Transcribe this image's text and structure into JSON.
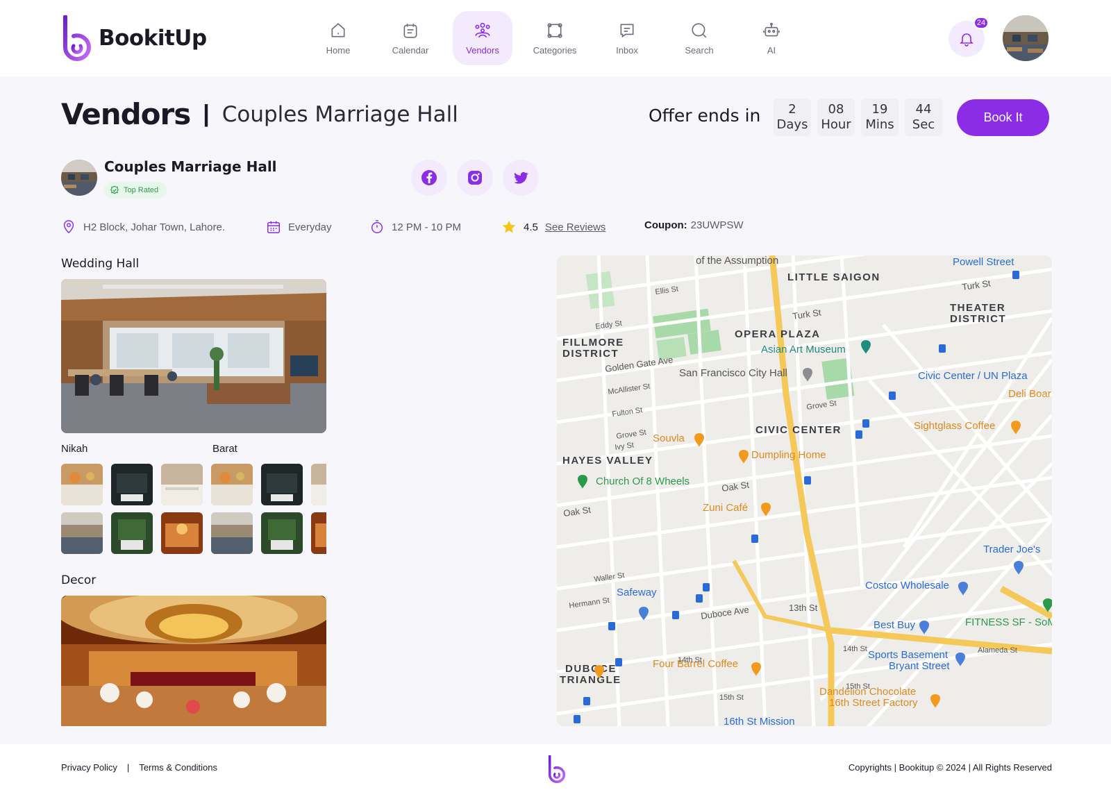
{
  "brand": {
    "name": "BookitUp",
    "accent": "#8b2de6"
  },
  "nav": [
    {
      "label": "Home",
      "icon": "home-icon"
    },
    {
      "label": "Calendar",
      "icon": "calendar-icon"
    },
    {
      "label": "Vendors",
      "icon": "vendors-icon",
      "active": true
    },
    {
      "label": "Categories",
      "icon": "categories-icon"
    },
    {
      "label": "Inbox",
      "icon": "inbox-icon"
    },
    {
      "label": "Search",
      "icon": "search-icon"
    },
    {
      "label": "AI",
      "icon": "robot-icon"
    }
  ],
  "notifications": {
    "count": "24"
  },
  "page": {
    "title": "Vendors",
    "separator": "|",
    "subtitle": "Couples Marriage Hall"
  },
  "offer": {
    "label": "Offer ends in",
    "days": "2",
    "days_label": "Days",
    "hours": "08",
    "hours_label": "Hour",
    "mins": "19",
    "mins_label": "Mins",
    "secs": "44",
    "secs_label": "Sec",
    "book_label": "Book It"
  },
  "vendor": {
    "name": "Couples Marriage Hall",
    "badge": "Top Rated",
    "address": "H2 Block, Johar Town, Lahore.",
    "days": "Everyday",
    "hours": "12 PM - 10 PM",
    "rating": "4.5",
    "reviews_link": "See Reviews",
    "coupon_label": "Coupon:",
    "coupon_code": "23UWPSW"
  },
  "sections": {
    "wedding_hall": "Wedding Hall",
    "nikah": "Nikah",
    "barat": "Barat",
    "decor": "Decor"
  },
  "map": {
    "labels": {
      "little_saigon": "LITTLE SAIGON",
      "assumption": "of the Assumption",
      "powell": "Powell Street",
      "theater": "THEATER",
      "district": "DISTRICT",
      "fillmore": "FILLMORE",
      "fillmore_district": "DISTRICT",
      "opera": "OPERA PLAZA",
      "asian": "Asian Art Museum",
      "city_hall": "San Francisco City Hall",
      "civic_un": "Civic Center / UN Plaza",
      "deli": "Deli Boar",
      "sightglass": "Sightglass Coffee",
      "civic": "CIVIC CENTER",
      "souvla": "Souvla",
      "dumpling": "Dumpling Home",
      "hayes": "HAYES VALLEY",
      "church": "Church Of 8 Wheels",
      "zuni": "Zuni Café",
      "trader": "Trader Joe's",
      "costco": "Costco Wholesale",
      "safeway": "Safeway",
      "best_buy": "Best Buy",
      "fitness": "FITNESS SF - SoM",
      "sports1": "Sports Basement",
      "sports2": "Bryant Street",
      "duboce": "DUBOCE",
      "triangle": "TRIANGLE",
      "four_barrel": "Four Barrel Coffee",
      "dandelion1": "Dandelion Chocolate",
      "dandelion2": "16th Street Factory",
      "mission16": "16th St Mission",
      "ellis": "Ellis St",
      "eddy": "Eddy St",
      "turk": "Turk St",
      "turk2": "Turk St",
      "golden": "Golden Gate Ave",
      "mcallister": "McAllister St",
      "fulton": "Fulton St",
      "grove": "Grove St",
      "grove2": "Grove St",
      "ivy": "Ivy St",
      "oak": "Oak St",
      "oak2": "Oak St",
      "waller": "Waller St",
      "hermann": "Hermann St",
      "duboce_ave": "Duboce Ave",
      "st13": "13th St",
      "st14": "14th St",
      "st14b": "14th St",
      "st15": "15th St",
      "st15b": "15th St",
      "alameda": "Alameda St"
    }
  },
  "footer": {
    "privacy": "Privacy Policy",
    "sep": "|",
    "terms": "Terms & Conditions",
    "copyright": "Copyrights | Bookitup © 2024 | All Rights Reserved"
  }
}
